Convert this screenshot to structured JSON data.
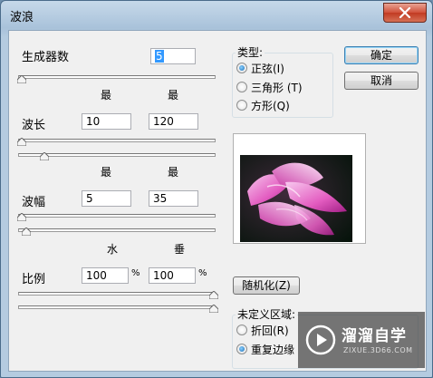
{
  "window": {
    "title": "波浪"
  },
  "generators": {
    "label": "生成器数",
    "value": "5",
    "slider_fraction": 0.0
  },
  "wavelength": {
    "label": "波长",
    "min_label": "最小",
    "max_label": "最大",
    "min_value": "10",
    "max_value": "120"
  },
  "amplitude": {
    "label": "波幅",
    "min_label": "最小",
    "max_label": "最大",
    "min_value": "5",
    "max_value": "35"
  },
  "scale": {
    "label": "比例",
    "h_label": "水平",
    "v_label": "垂直",
    "h_value": "100",
    "v_value": "100",
    "unit": "%"
  },
  "type": {
    "label": "类型:",
    "options": [
      {
        "label": "正弦(I)",
        "selected": true
      },
      {
        "label": "三角形 (T)",
        "selected": false
      },
      {
        "label": "方形(Q)",
        "selected": false
      }
    ]
  },
  "buttons": {
    "ok": "确定",
    "cancel": "取消",
    "randomize": "随机化(Z)"
  },
  "undefined_area": {
    "label": "未定义区域:",
    "options": [
      {
        "label": "折回(R)",
        "selected": false
      },
      {
        "label": "重复边缘",
        "selected": true
      }
    ]
  },
  "watermark": {
    "brand": "溜溜自学",
    "site": "ZIXUE.3D66.COM"
  },
  "colors": {
    "accent": "#3399ff",
    "close": "#c13a22"
  }
}
